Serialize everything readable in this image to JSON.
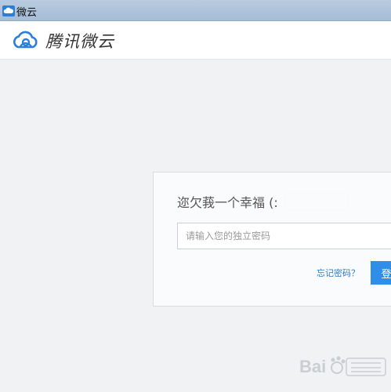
{
  "window": {
    "title": "微云",
    "icon": "weiyun-cloud-icon"
  },
  "header": {
    "logo_text": "腾讯微云",
    "logo_icon": "cloud-logo-icon"
  },
  "login": {
    "nickname": "迩欠莪一个幸福 (:",
    "password_placeholder": "请输入您的独立密码",
    "forgot_label": "忘记密码？",
    "login_label": "登"
  },
  "colors": {
    "accent": "#2f8ee8",
    "link": "#2f7cc4",
    "background": "#f1f2f4"
  }
}
